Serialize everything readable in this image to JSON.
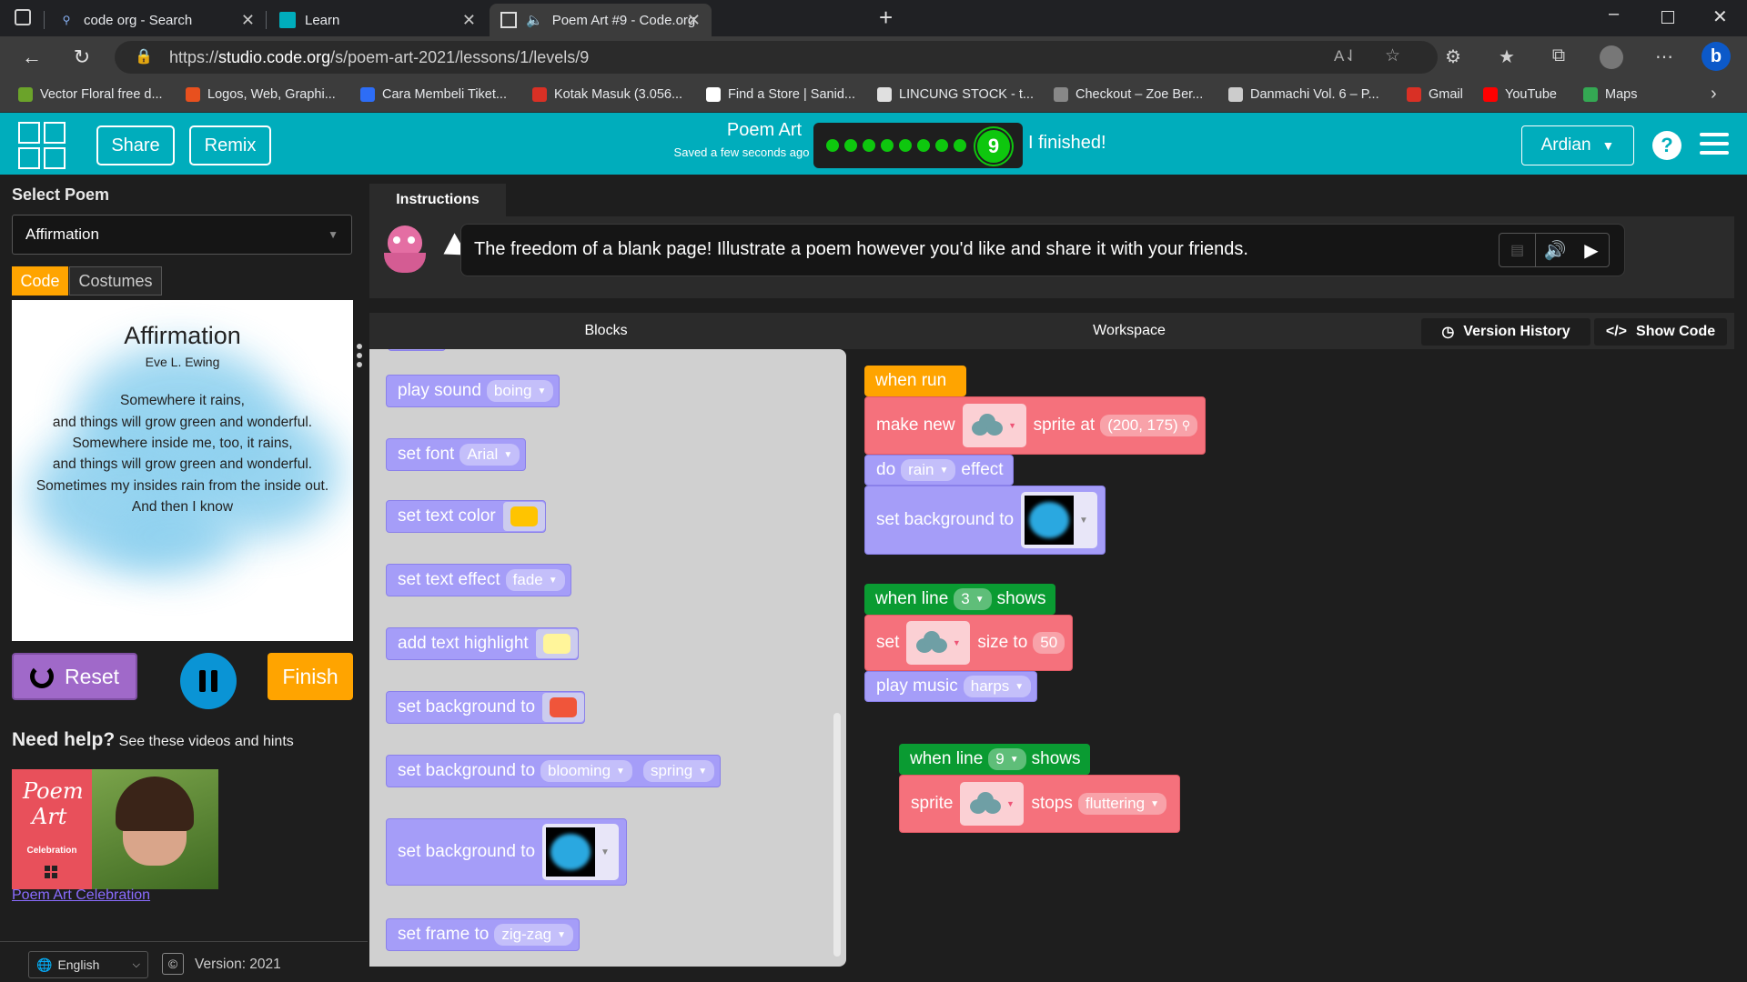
{
  "browser": {
    "tabs": [
      {
        "title": "code org - Search"
      },
      {
        "title": "Learn"
      },
      {
        "title": "Poem Art #9 - Code.org"
      }
    ],
    "url_prefix": "https://",
    "url_host": "studio.code.org",
    "url_path": "/s/poem-art-2021/lessons/1/levels/9",
    "bookmarks": [
      {
        "label": "Vector Floral free d...",
        "color": "#6ba32a"
      },
      {
        "label": "Logos, Web, Graphi...",
        "color": "#e8501e"
      },
      {
        "label": "Cara Membeli Tiket...",
        "color": "#2d6df6"
      },
      {
        "label": "Kotak Masuk (3.056...",
        "color": "#d93025"
      },
      {
        "label": "Find a Store | Sanid...",
        "color": "#ffffff"
      },
      {
        "label": "LINCUNG STOCK - t...",
        "color": "#e0e0e0"
      },
      {
        "label": "Checkout – Zoe Ber...",
        "color": "#888888"
      },
      {
        "label": "Danmachi Vol. 6 – P...",
        "color": "#cccccc"
      },
      {
        "label": "Gmail",
        "color": "#d93025"
      },
      {
        "label": "YouTube",
        "color": "#ff0000"
      },
      {
        "label": "Maps",
        "color": "#34a853"
      }
    ]
  },
  "header": {
    "share": "Share",
    "remix": "Remix",
    "level_title": "Poem Art",
    "saved_note": "Saved a few seconds ago",
    "current_level": "9",
    "finished_text": "I finished!",
    "user": "Ardian",
    "help": "?",
    "accent": "#00adbc"
  },
  "left": {
    "select_label": "Select Poem",
    "selected_poem": "Affirmation",
    "tab_code": "Code",
    "tab_costumes": "Costumes",
    "poem": {
      "title": "Affirmation",
      "author": "Eve L. Ewing",
      "lines": [
        "Somewhere it rains,",
        "and things will grow green and wonderful.",
        "Somewhere inside me, too, it rains,",
        "and things will grow green and wonderful.",
        "Sometimes my insides rain from the inside out.",
        "And then I know"
      ]
    },
    "reset": "Reset",
    "finish": "Finish",
    "help_title": "Need help?",
    "help_sub": "See these videos and hints",
    "video_title_1": "Poem",
    "video_title_2": "Art",
    "video_tag": "Celebration",
    "video_link": "Poem Art Celebration",
    "language": "English",
    "version": "Version: 2021"
  },
  "instructions": {
    "tab": "Instructions",
    "text": "The freedom of a blank page! Illustrate a poem however you'd like and share it with your friends."
  },
  "workspace_header": {
    "blocks": "Blocks",
    "workspace": "Workspace",
    "version_history": "Version History",
    "show_code": "Show Code"
  },
  "toolbox": {
    "play_sound": "play sound",
    "play_sound_val": "boing",
    "set_font": "set font",
    "set_font_val": "Arial",
    "set_text_color": "set text color",
    "text_color": "#ffc400",
    "set_text_effect": "set text effect",
    "text_effect_val": "fade",
    "add_text_highlight": "add text highlight",
    "highlight_color": "#fff59a",
    "set_background": "set background to",
    "bg_color": "#f0553a",
    "bg_pattern_a": "blooming",
    "bg_pattern_b": "spring",
    "set_frame": "set frame to",
    "frame_val": "zig-zag"
  },
  "program": {
    "when_run": "when run",
    "make_new": "make new",
    "sprite_at": "sprite at",
    "sprite_at_val": "(200, 175)",
    "do": "do",
    "do_val": "rain",
    "effect": "effect",
    "set_background": "set background to",
    "when_line": "when line",
    "line_a": "3",
    "shows": "shows",
    "set": "set",
    "size_to": "size to",
    "size_val": "50",
    "play_music": "play music",
    "music_val": "harps",
    "line_b": "9",
    "sprite": "sprite",
    "stops": "stops",
    "stops_val": "fluttering"
  }
}
